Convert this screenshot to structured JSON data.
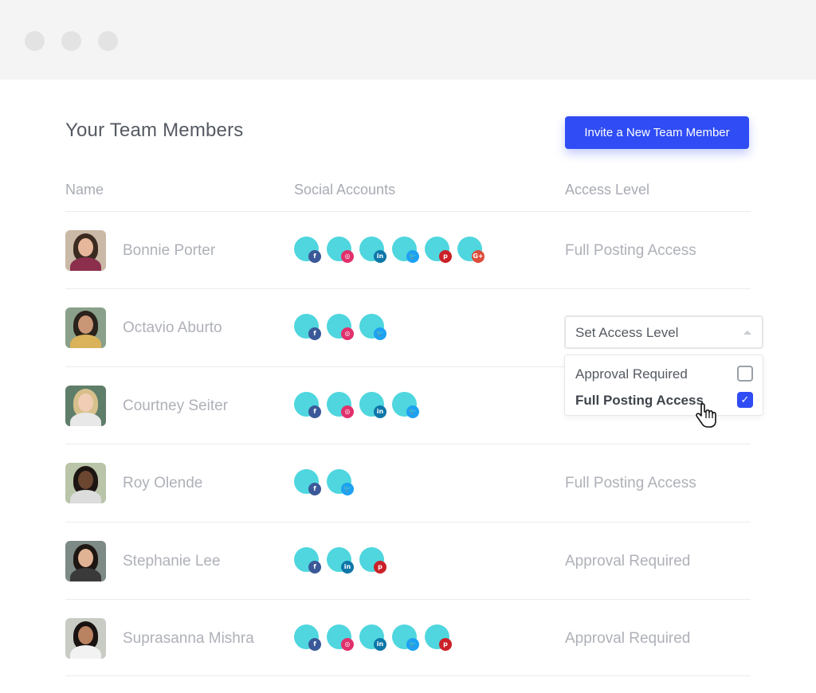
{
  "page": {
    "title": "Your Team Members",
    "invite_label": "Invite a New Team Member"
  },
  "columns": {
    "name": "Name",
    "social": "Social Accounts",
    "access": "Access Level"
  },
  "members": [
    {
      "name": "Bonnie Porter",
      "socials": [
        "facebook",
        "instagram",
        "linkedin",
        "twitter",
        "pinterest",
        "google-plus"
      ],
      "access": "Full Posting Access"
    },
    {
      "name": "Octavio Aburto",
      "socials": [
        "facebook",
        "instagram",
        "twitter"
      ],
      "access": ""
    },
    {
      "name": "Courtney Seiter",
      "socials": [
        "facebook",
        "instagram",
        "linkedin",
        "twitter"
      ],
      "access": ""
    },
    {
      "name": "Roy Olende",
      "socials": [
        "facebook",
        "twitter"
      ],
      "access": "Full Posting Access"
    },
    {
      "name": "Stephanie Lee",
      "socials": [
        "facebook",
        "linkedin",
        "pinterest"
      ],
      "access": "Approval Required"
    },
    {
      "name": "Suprasanna Mishra",
      "socials": [
        "facebook",
        "instagram",
        "linkedin",
        "twitter",
        "pinterest"
      ],
      "access": "Approval Required"
    }
  ],
  "access_dropdown": {
    "label": "Set Access Level",
    "options": [
      {
        "label": "Approval Required",
        "checked": false
      },
      {
        "label": "Full Posting Access",
        "checked": true
      }
    ]
  },
  "social_badges": {
    "facebook": {
      "glyph": "f",
      "color": "#3b5998"
    },
    "instagram": {
      "glyph": "◎",
      "color": "#e1306c"
    },
    "linkedin": {
      "glyph": "in",
      "color": "#0e76a8"
    },
    "twitter": {
      "glyph": "🐦",
      "color": "#1da1f2"
    },
    "pinterest": {
      "glyph": "p",
      "color": "#cb2027"
    },
    "google-plus": {
      "glyph": "G+",
      "color": "#dd4b39"
    }
  },
  "colors": {
    "accent": "#2f4cf5",
    "social_circle": "#4fd6de"
  }
}
